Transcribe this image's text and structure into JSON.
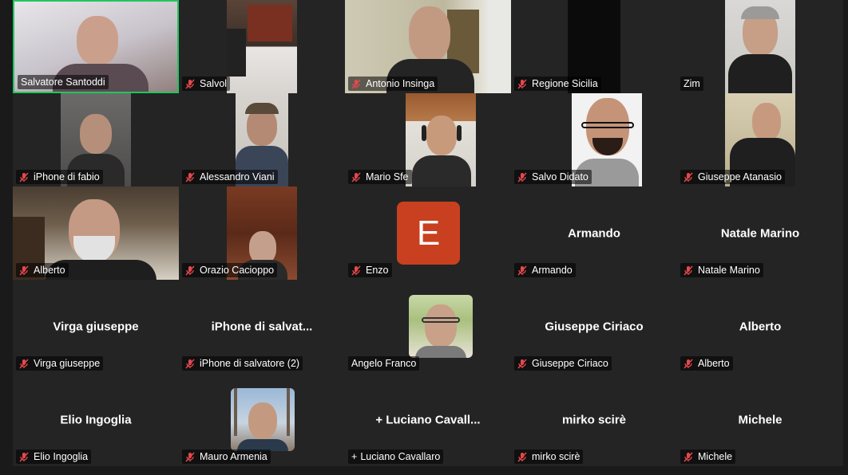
{
  "participants": [
    {
      "name": "Salvatore Santoddi",
      "muted": false,
      "active": true
    },
    {
      "name": "Salvol",
      "muted": true
    },
    {
      "name": "Antonio Insinga",
      "muted": true
    },
    {
      "name": "Regione Sicilia",
      "muted": true
    },
    {
      "name": "Zim",
      "muted": false
    },
    {
      "name": "iPhone di fabio",
      "muted": true
    },
    {
      "name": "Alessandro Viani",
      "muted": true
    },
    {
      "name": "Mario Sfe",
      "muted": true
    },
    {
      "name": "Salvo Didato",
      "muted": true
    },
    {
      "name": "Giuseppe Atanasio",
      "muted": true
    },
    {
      "name": "Alberto",
      "muted": true
    },
    {
      "name": "Orazio Cacioppo",
      "muted": true
    },
    {
      "name": "Enzo",
      "muted": true,
      "avatar_letter": "E"
    },
    {
      "name": "Armando",
      "muted": true,
      "center_name": "Armando"
    },
    {
      "name": "Natale Marino",
      "muted": true,
      "center_name": "Natale Marino"
    },
    {
      "name": "Virga giuseppe",
      "muted": true,
      "center_name": "Virga giuseppe"
    },
    {
      "name": "iPhone di salvatore (2)",
      "muted": true,
      "center_name": "iPhone di salvat..."
    },
    {
      "name": "Angelo Franco",
      "muted": false
    },
    {
      "name": "Giuseppe Ciriaco",
      "muted": true,
      "center_name": "Giuseppe Ciriaco"
    },
    {
      "name": "Alberto",
      "muted": true,
      "center_name": "Alberto"
    },
    {
      "name": "Elio Ingoglia",
      "muted": true,
      "center_name": "Elio Ingoglia"
    },
    {
      "name": "Mauro Armenia",
      "muted": true
    },
    {
      "name": "Luciano Cavallaro",
      "muted": false,
      "phone": true,
      "center_name": "Luciano Cavall..."
    },
    {
      "name": "mirko scirè",
      "muted": true,
      "center_name": "mirko scirè"
    },
    {
      "name": "Michele",
      "muted": true,
      "center_name": "Michele"
    }
  ],
  "colors": {
    "active_border": "#22c55e",
    "mute_icon": "#e5484d",
    "avatar_bg": "#c8401f"
  }
}
